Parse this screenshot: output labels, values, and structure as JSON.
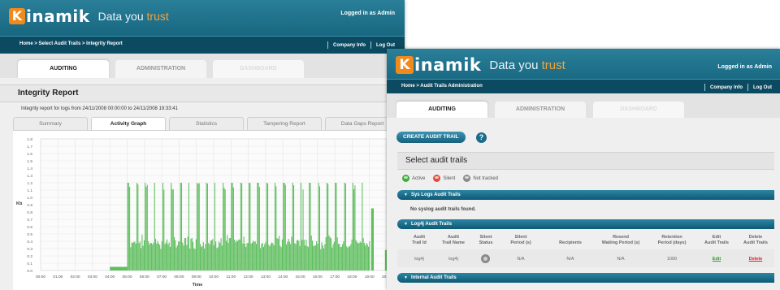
{
  "w1": {
    "logo_word": "inamik",
    "logo_letter": "K",
    "tagline_main": "Data you ",
    "tagline_accent": "trust",
    "logged_in": "Logged in as Admin",
    "breadcrumb": "Home > Select Audit Trails > Integrity Report",
    "nav": {
      "company_info": "Company Info",
      "log_out": "Log Out"
    },
    "tabs": {
      "auditing": "AUDITING",
      "administration": "ADMINISTRATION",
      "dashboard": "DASHBOARD"
    },
    "report_title": "Integrity Report",
    "report_sub": "Integrity report for logs from 24/11/2008 00:00:00 to 24/11/2008 19:33:41",
    "subtabs": [
      "Summary",
      "Activity Graph",
      "Statistics",
      "Tampering Report",
      "Data Gaps Report"
    ]
  },
  "chart_data": {
    "type": "bar",
    "ylabel": "Kb",
    "xlabel": "Time",
    "ylim": [
      0,
      1.8
    ],
    "yticks": [
      "0.0",
      "0.1",
      "0.2",
      "0.3",
      "0.4",
      "0.5",
      "0.6",
      "0.7",
      "0.8",
      "0.9",
      "1.0",
      "1.1",
      "1.2",
      "1.3",
      "1.4",
      "1.5",
      "1.6",
      "1.7",
      "1.8"
    ],
    "categories": [
      "00:00",
      "01:00",
      "02:00",
      "03:00",
      "04:00",
      "05:00",
      "06:00",
      "07:00",
      "08:00",
      "09:00",
      "10:00",
      "11:00",
      "12:00",
      "13:00",
      "14:00",
      "15:00",
      "16:00",
      "17:00",
      "18:00",
      "19:00",
      "20:00"
    ],
    "grid": true,
    "color": "#5fbf5f",
    "series": [
      {
        "x_start": 4.0,
        "x_end": 5.0,
        "level": 0.05
      },
      {
        "x_start": 5.0,
        "x_end": 19.0,
        "base": 0.4,
        "peak": 1.2,
        "low": 0.28
      }
    ],
    "late_bar": {
      "x_start": 19.1,
      "x_end": 19.25,
      "level": 0.85
    },
    "end_bar": {
      "x_start": 19.9,
      "x_end": 20.1,
      "level": 0.28
    }
  },
  "w2": {
    "logo_word": "inamik",
    "logo_letter": "K",
    "tagline_main": "Data you ",
    "tagline_accent": "trust",
    "logged_in": "Logged in as Admin",
    "breadcrumb": "Home > Audit Trails Administration",
    "nav": {
      "company_info": "Company Info",
      "log_out": "Log Out"
    },
    "tabs": {
      "auditing": "AUDITING",
      "administration": "ADMINISTRATION",
      "dashboard": "DASHBOARD"
    },
    "create_btn": "CREATE AUDIT TRAIL",
    "help": "?",
    "select_title": "Select audit trails",
    "legend": {
      "active": "Active",
      "silent": "Silent",
      "not_tracked": "Not tracked"
    },
    "colors": {
      "active": "#3cae3c",
      "silent": "#e24a3b",
      "not_tracked": "#8a8a8a"
    },
    "sections": {
      "syslog": "Sys Logs Audit Trails",
      "syslog_empty": "No syslog audit trails found.",
      "log4j": "Log4j Audit Trails",
      "internal": "Internal Audit Trails"
    },
    "table": {
      "headers": [
        [
          "Audit",
          "Trail Id"
        ],
        [
          "Audit",
          "Trail Name"
        ],
        [
          "Silent",
          "Status"
        ],
        [
          "Silent",
          "Period (s)"
        ],
        [
          "Recipients",
          ""
        ],
        [
          "Resend",
          "Waiting Period (s)"
        ],
        [
          "Retention",
          "Period (days)"
        ],
        [
          "Edit",
          "Audit Trails"
        ],
        [
          "Delete",
          "Audit Trails"
        ]
      ],
      "row": {
        "id": "log4j",
        "name": "log4j",
        "silent_period": "N/A",
        "recipients": "N/A",
        "resend": "N/A",
        "retention": "1000",
        "edit": "Edit",
        "delete": "Delete"
      }
    }
  }
}
